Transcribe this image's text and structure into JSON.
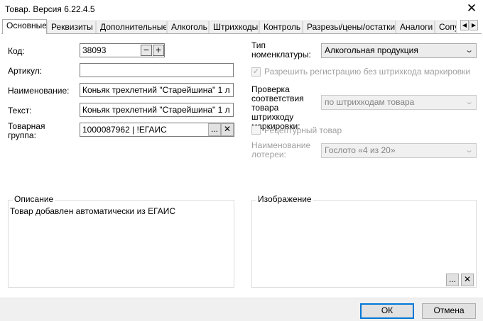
{
  "window": {
    "title": "Товар. Версия 6.22.4.5",
    "close_glyph": "✕"
  },
  "tabs": [
    {
      "label": "Основные",
      "active": true
    },
    {
      "label": "Реквизиты"
    },
    {
      "label": "Дополнительные"
    },
    {
      "label": "Алкоголь"
    },
    {
      "label": "Штрихкоды"
    },
    {
      "label": "Контроль"
    },
    {
      "label": "Разрезы/цены/остатки"
    },
    {
      "label": "Аналоги"
    },
    {
      "label": "Сопут"
    }
  ],
  "tab_scroll": {
    "left": "◀",
    "right": "▶"
  },
  "form": {
    "code_label": "Код:",
    "code_value": "38093",
    "code_minus": "−",
    "code_plus": "+",
    "article_label": "Артикул:",
    "article_value": "",
    "name_label": "Наименование:",
    "name_value": "Коньяк трехлетний \"Старейшина\" 1 л",
    "text_label": "Текст:",
    "text_value": "Коньяк трехлетний \"Старейшина\" 1 л",
    "group_label": "Товарная группа:",
    "group_value": "1000087962 | !ЕГАИС",
    "group_browse": "...",
    "group_clear": "✕"
  },
  "right": {
    "nomenclature_label": "Тип номенклатуры:",
    "nomenclature_value": "Алкогольная продукция",
    "allow_reg_label": "Разрешить регистрацию без штрихкода маркировки",
    "allow_reg_checked": "✓",
    "check_label": "Проверка соответствия товара штрихкоду маркировки:",
    "check_value": "по штрихкодам товара",
    "recipe_label": "Рецептурный товар",
    "lottery_label": "Наименование лотереи:",
    "lottery_value": "Гослото «4 из 20»",
    "chevron": "⌄"
  },
  "description": {
    "legend": "Описание",
    "text": "Товар добавлен автоматически из ЕГАИС"
  },
  "image": {
    "legend": "Изображение",
    "browse": "...",
    "clear": "✕"
  },
  "footer": {
    "ok": "ОК",
    "cancel": "Отмена"
  }
}
